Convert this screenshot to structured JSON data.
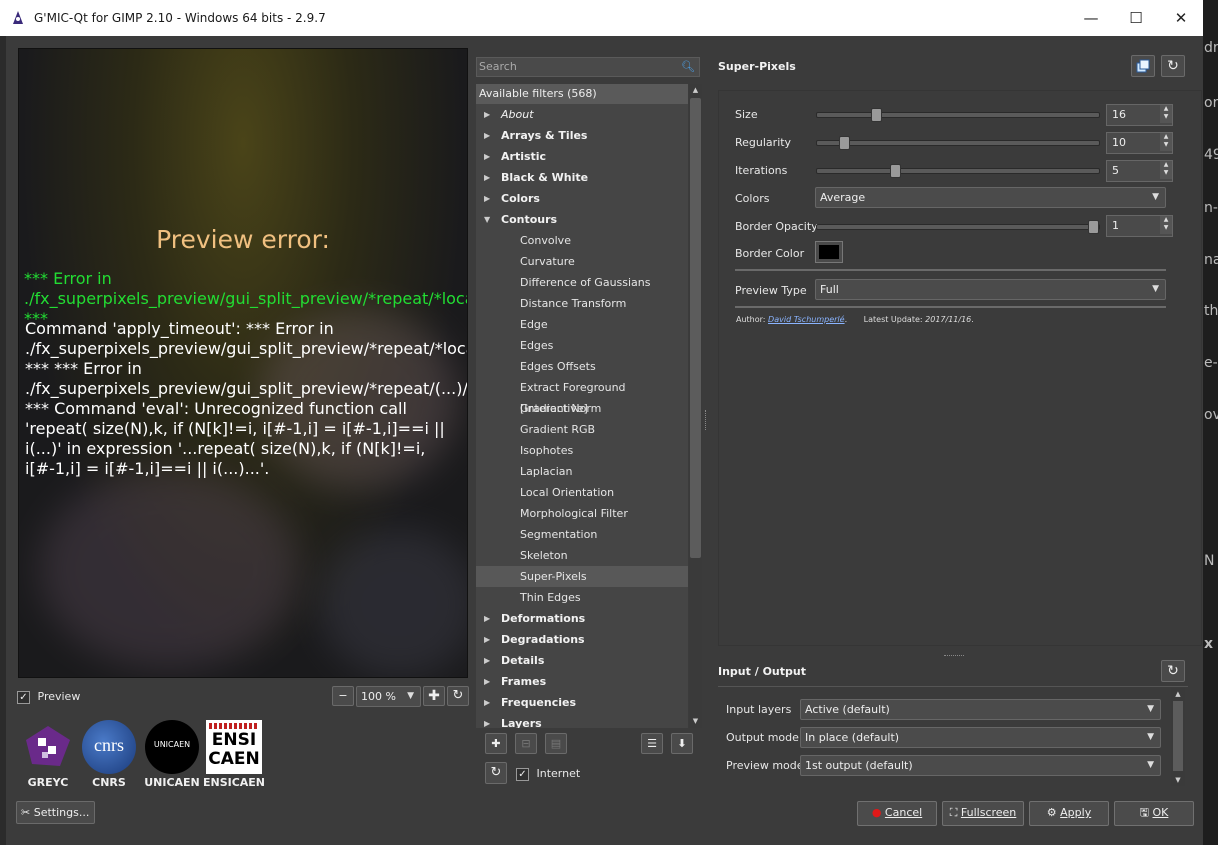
{
  "window": {
    "title": "G'MIC-Qt for GIMP 2.10 - Windows 64 bits - 2.9.7",
    "minimize": "—",
    "maximize": "☐",
    "close": "✕"
  },
  "background_strip": [
    "dr",
    "or",
    "49",
    "n-",
    "na",
    "th",
    "e-",
    "ov",
    "N",
    "x"
  ],
  "preview": {
    "error_title": "Preview error:",
    "error_green": "*** Error in ./fx_superpixels_preview/gui_split_preview/*repeat/*local/*local/ ***",
    "error_white": "Command 'apply_timeout': *** Error in ./fx_superpixels_preview/gui_split_preview/*repeat/*local/*local/apply_timeout/*if/*local/ *** *** Error in ./fx_superpixels_preview/gui_split_preview/*repeat/(...)/*local/slic/*repeat/*local/ *** Command 'eval': Unrecognized function call 'repeat( size(N),k,  if  (N[k]!=i,  i[#-1,i] = i[#-1,i]==i || i(...)' in expression '...repeat( size(N),k,  if (N[k]!=i,  i[#-1,i] = i[#-1,i]==i || i(...)...'.",
    "checkbox_label": "Preview",
    "checked": true,
    "zoom": "100 %"
  },
  "logos": [
    "GREYC",
    "CNRS",
    "UNICAEN",
    "ENSICAEN"
  ],
  "logo_text": {
    "cnrs": "cnrs",
    "unicaen": "UNICAEN",
    "ensi1": "ENSI",
    "ensi2": "CAEN"
  },
  "settings_label": "Settings...",
  "search_placeholder": "Search",
  "filters": {
    "header": "Available filters (568)",
    "tree": [
      {
        "label": "About",
        "type": "cat-italic"
      },
      {
        "label": "Arrays & Tiles",
        "type": "cat"
      },
      {
        "label": "Artistic",
        "type": "cat"
      },
      {
        "label": "Black & White",
        "type": "cat"
      },
      {
        "label": "Colors",
        "type": "cat"
      },
      {
        "label": "Contours",
        "type": "open"
      },
      {
        "label": "Convolve",
        "type": "leaf"
      },
      {
        "label": "Curvature",
        "type": "leaf"
      },
      {
        "label": "Difference of Gaussians",
        "type": "leaf"
      },
      {
        "label": "Distance Transform",
        "type": "leaf"
      },
      {
        "label": "Edge",
        "type": "leaf"
      },
      {
        "label": "Edges",
        "type": "leaf"
      },
      {
        "label": "Edges Offsets",
        "type": "leaf"
      },
      {
        "label": "Extract Foreground [Interactive]",
        "type": "leaf"
      },
      {
        "label": "Gradient Norm",
        "type": "leaf"
      },
      {
        "label": "Gradient RGB",
        "type": "leaf"
      },
      {
        "label": "Isophotes",
        "type": "leaf"
      },
      {
        "label": "Laplacian",
        "type": "leaf"
      },
      {
        "label": "Local Orientation",
        "type": "leaf"
      },
      {
        "label": "Morphological Filter",
        "type": "leaf"
      },
      {
        "label": "Segmentation",
        "type": "leaf"
      },
      {
        "label": "Skeleton",
        "type": "leaf"
      },
      {
        "label": "Super-Pixels",
        "type": "leaf-selected"
      },
      {
        "label": "Thin Edges",
        "type": "leaf"
      },
      {
        "label": "Deformations",
        "type": "cat"
      },
      {
        "label": "Degradations",
        "type": "cat"
      },
      {
        "label": "Details",
        "type": "cat"
      },
      {
        "label": "Frames",
        "type": "cat"
      },
      {
        "label": "Frequencies",
        "type": "cat"
      },
      {
        "label": "Layers",
        "type": "cat"
      }
    ],
    "internet_label": "Internet",
    "internet_checked": true
  },
  "filter_panel": {
    "name": "Super-Pixels",
    "params": [
      {
        "label": "Size",
        "value": "16",
        "fraction": 0.2
      },
      {
        "label": "Regularity",
        "value": "10",
        "fraction": 0.08
      },
      {
        "label": "Iterations",
        "value": "5",
        "fraction": 0.27
      }
    ],
    "colors_label": "Colors",
    "colors_value": "Average",
    "border_opacity_label": "Border Opacity",
    "border_opacity_value": "1",
    "border_opacity_fraction": 1.0,
    "border_color_label": "Border Color",
    "border_color": "#000000",
    "preview_type_label": "Preview Type",
    "preview_type_value": "Full",
    "author_prefix": "Author:",
    "author_name": "David Tschumperlé",
    "update_prefix": "Latest Update:",
    "update_date": "2017/11/16"
  },
  "io": {
    "title": "Input / Output",
    "input_label": "Input layers",
    "input_value": "Active (default)",
    "output_label": "Output mode",
    "output_value": "In place (default)",
    "preview_label": "Preview mode",
    "preview_value": "1st output (default)"
  },
  "buttons": {
    "cancel": "Cancel",
    "fullscreen": "Fullscreen",
    "apply": "Apply",
    "ok": "OK"
  }
}
